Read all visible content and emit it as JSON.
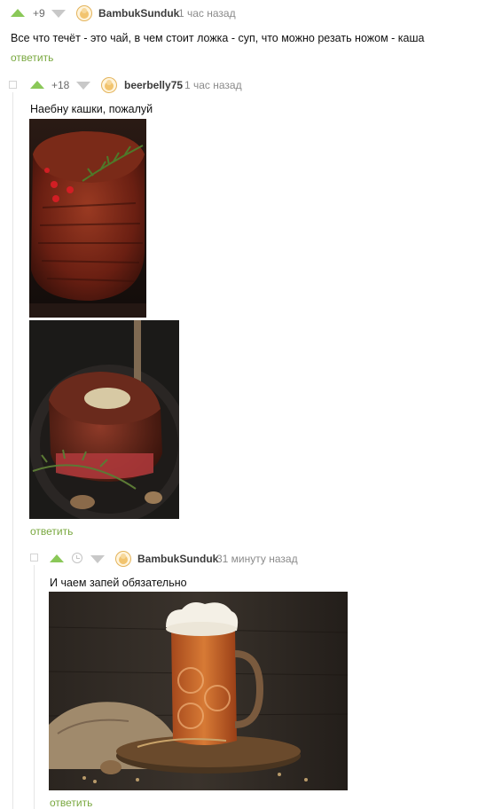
{
  "comments": [
    {
      "rating": "+9",
      "author": "BambukSunduk",
      "time": "1 час назад",
      "text": "Все что течёт - это чай, в чем стоит ложка - суп, что можно резать ножом - каша",
      "reply": "ответить"
    },
    {
      "rating": "+18",
      "author": "beerbelly75",
      "time": "1 час назад",
      "text": "Наебну кашки, пожалуй",
      "images": [
        "steak-photo-1",
        "steak-photo-2"
      ],
      "reply": "ответить"
    },
    {
      "author": "BambukSunduk",
      "time": "31 минуту назад",
      "text": "И чаем запей обязательно",
      "images": [
        "beer-mug-photo"
      ],
      "reply": "ответить"
    }
  ],
  "colors": {
    "upvote": "#8ac858",
    "downvote": "#c8c8c8",
    "reply_link": "#79a83f",
    "meta": "#8a8a8a"
  }
}
